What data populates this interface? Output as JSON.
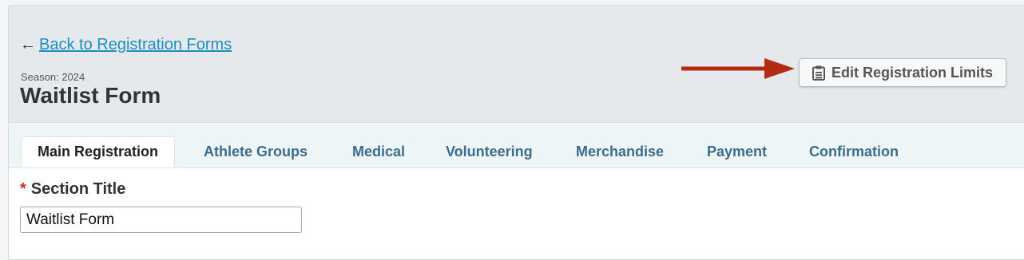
{
  "header": {
    "back_arrow": "←",
    "back_link": "Back to Registration Forms",
    "season": "Season: 2024",
    "title": "Waitlist Form",
    "edit_button": "Edit Registration Limits",
    "edit_icon": "clipboard-icon",
    "arrow_color": "#b42a15"
  },
  "tabs": [
    {
      "label": "Main Registration",
      "active": true
    },
    {
      "label": "Athlete Groups"
    },
    {
      "label": "Medical"
    },
    {
      "label": "Volunteering"
    },
    {
      "label": "Merchandise"
    },
    {
      "label": "Payment"
    },
    {
      "label": "Confirmation"
    }
  ],
  "form": {
    "required_marker": "*",
    "section_title_label": "Section Title",
    "section_title_value": "Waitlist Form"
  }
}
